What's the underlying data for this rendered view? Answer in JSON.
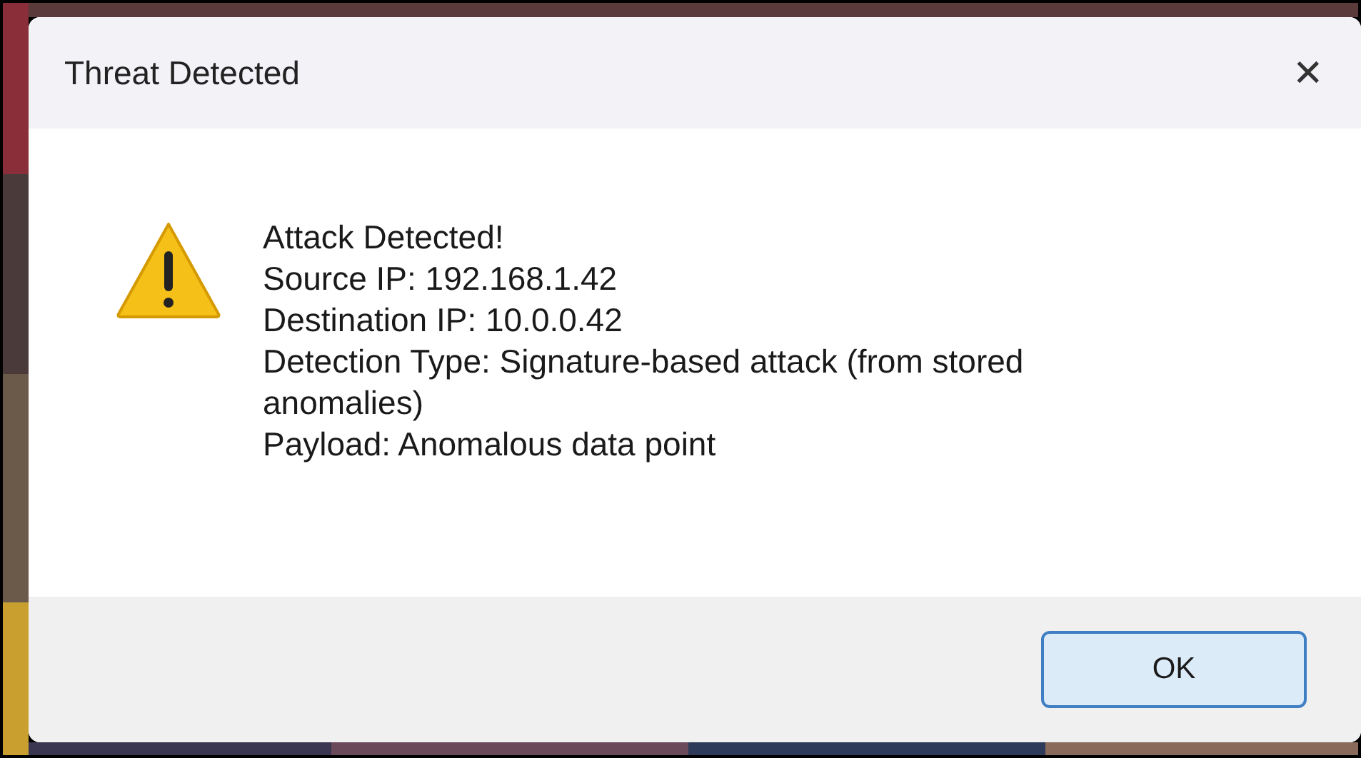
{
  "window": {
    "title": "Threat Detected",
    "close": "✕"
  },
  "message": {
    "lines": [
      "Attack Detected!",
      "Source IP: 192.168.1.42",
      "Destination IP: 10.0.0.42",
      "Detection Type: Signature-based attack (from stored anomalies)",
      "Payload: Anomalous data point"
    ]
  },
  "buttons": [
    {
      "label": "OK",
      "default": true
    }
  ]
}
